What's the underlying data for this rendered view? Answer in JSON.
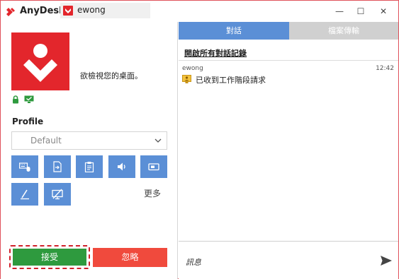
{
  "titlebar": {
    "app_name": "AnyDesk",
    "session_tab": "ewong",
    "minimize": "—",
    "maximize": "☐",
    "close": "✕"
  },
  "request": {
    "text": "欲檢視您的桌面。",
    "profile_label": "Profile",
    "profile_value": "Default",
    "more_label": "更多",
    "accept_label": "接受",
    "ignore_label": "忽略"
  },
  "permissions": [
    {
      "icon": "keyboard-mouse-icon"
    },
    {
      "icon": "file-transfer-icon"
    },
    {
      "icon": "clipboard-icon"
    },
    {
      "icon": "sound-icon"
    },
    {
      "icon": "recording-icon"
    },
    {
      "icon": "draw-icon"
    },
    {
      "icon": "privacy-screen-icon"
    }
  ],
  "tabs": {
    "chat": "對話",
    "file_transfer": "檔案傳輸"
  },
  "chat": {
    "open_log": "開啟所有對話記錄",
    "messages": [
      {
        "sender": "ewong",
        "time": "12:42",
        "text": "已收到工作階段請求"
      }
    ],
    "input_placeholder": "訊息"
  },
  "colors": {
    "brand_red": "#e3262c",
    "accent_blue": "#5b8fd6",
    "accept_green": "#2e9a3e",
    "ignore_red": "#f04a3d",
    "tab_inactive": "#d0d0d0"
  }
}
